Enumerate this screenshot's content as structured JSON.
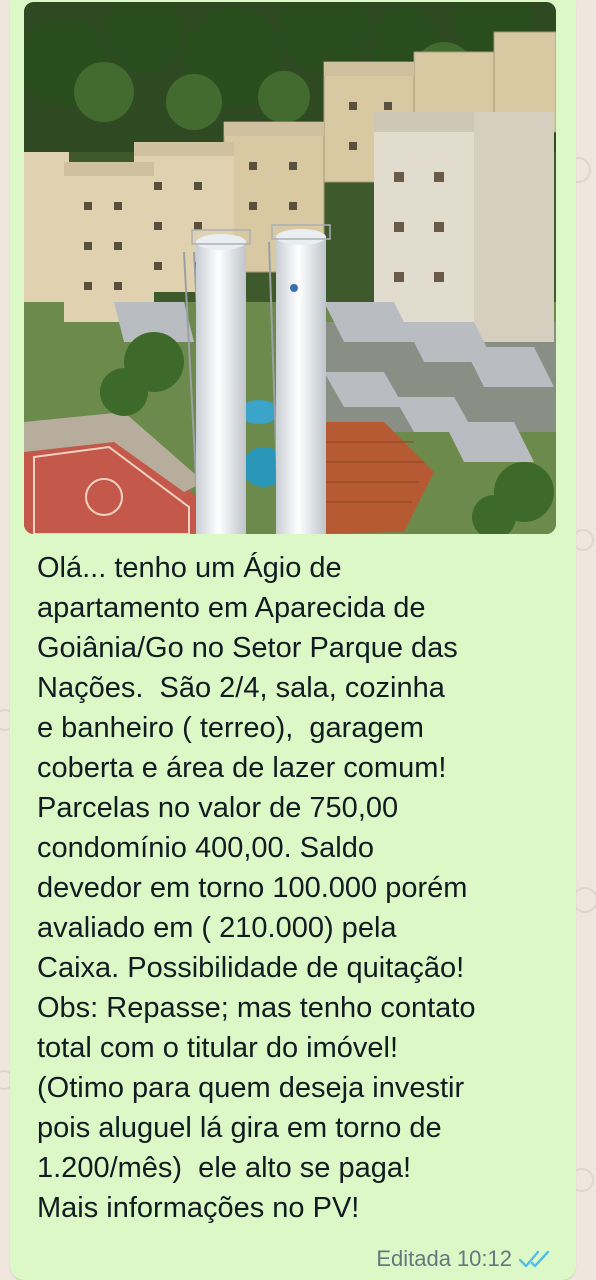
{
  "message": {
    "text": "Olá... tenho um Ágio de\napartamento em Aparecida de\nGoiânia/Go no Setor Parque das\nNações.  São 2/4, sala, cozinha\ne banheiro ( terreo),  garagem\ncoberta e área de lazer comum!\nParcelas no valor de 750,00\ncondomínio 400,00. Saldo\ndevedor em torno 100.000 porém\navaliado em ( 210.000) pela\nCaixa. Possibilidade de quitação!\nObs: Repasse; mas tenho contato\ntotal com o titular do imóvel!\n(Otimo para quem deseja investir\npois aluguel lá gira em torno de\n1.200/mês)  ele alto se paga!\nMais informações no PV!",
    "edited_label": "Editada",
    "time": "10:12",
    "status_icon": "double-check-read-icon"
  },
  "image": {
    "subject": "apartment-complex-photo"
  },
  "colors": {
    "bubble": "#dcf8c6",
    "background": "#efe7de",
    "text": "#111b21",
    "meta": "#667781",
    "read_ticks": "#53bdeb"
  }
}
